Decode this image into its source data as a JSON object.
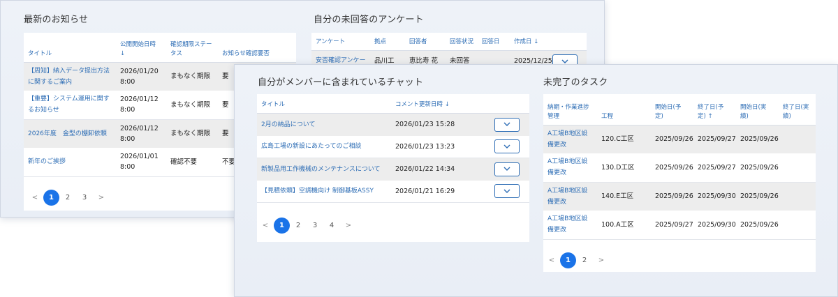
{
  "back": {
    "news": {
      "title": "最新のお知らせ",
      "headers": [
        "タイトル",
        "公開開始日時 ↓",
        "確認期限ステータス",
        "お知らせ確認要否"
      ],
      "rows": [
        {
          "title": "【周知】納入データ提出方法に関するご案内",
          "date": "2026/01/20",
          "time": "8:00",
          "status": "まもなく期限",
          "req": "要"
        },
        {
          "title": "【重要】システム運用に関するお知らせ",
          "date": "2026/01/12",
          "time": "8:00",
          "status": "まもなく期限",
          "req": "要"
        },
        {
          "title": "2026年度　金型の棚卸依頼",
          "date": "2026/01/12",
          "time": "8:00",
          "status": "まもなく期限",
          "req": "要"
        },
        {
          "title": "新年のご挨拶",
          "date": "2026/01/01",
          "time": "8:00",
          "status": "確認不要",
          "req": "不要"
        }
      ],
      "pager": {
        "prev": "<",
        "pages": [
          "1",
          "2",
          "3"
        ],
        "next": ">"
      }
    },
    "survey": {
      "title": "自分の未回答のアンケート",
      "headers": [
        "アンケート",
        "拠点",
        "回答者",
        "回答状況",
        "回答日",
        "作成日 ↓"
      ],
      "row": {
        "name": "安否確認アンケー",
        "site": "品川工",
        "person": "恵比寿 花",
        "status": "未回答",
        "answered": "",
        "created": "2025/12/25"
      }
    }
  },
  "front": {
    "chat": {
      "title": "自分がメンバーに含まれているチャット",
      "headers": [
        "タイトル",
        "コメント更新日時 ↓"
      ],
      "rows": [
        {
          "title": "2月の納品について",
          "datetime": "2026/01/23 15:28"
        },
        {
          "title": "広島工場の新設にあたってのご相談",
          "datetime": "2026/01/23 13:23"
        },
        {
          "title": "新製品用工作機械のメンテナンスについて",
          "datetime": "2026/01/22 14:34"
        },
        {
          "title": "【見積依頼】空調機向け 制御基板ASSY",
          "datetime": "2026/01/21 16:29"
        }
      ],
      "pager": {
        "prev": "<",
        "pages": [
          "1",
          "2",
          "3",
          "4"
        ],
        "next": ">"
      }
    },
    "tasks": {
      "title": "未完了のタスク",
      "headers": [
        "納期・作業進捗管理",
        "工程",
        "開始日(予定)",
        "終了日(予定) ↑",
        "開始日(実績)",
        "終了日(実績)"
      ],
      "rows": [
        {
          "name": "A工場B地区設備更改",
          "step": "120.C工区",
          "start_plan": "2025/09/26",
          "end_plan": "2025/09/27",
          "start_act": "2025/09/26",
          "end_act": ""
        },
        {
          "name": "A工場B地区設備更改",
          "step": "130.D工区",
          "start_plan": "2025/09/26",
          "end_plan": "2025/09/27",
          "start_act": "2025/09/26",
          "end_act": ""
        },
        {
          "name": "A工場B地区設備更改",
          "step": "140.E工区",
          "start_plan": "2025/09/26",
          "end_plan": "2025/09/30",
          "start_act": "2025/09/26",
          "end_act": ""
        },
        {
          "name": "A工場B地区設備更改",
          "step": "100.A工区",
          "start_plan": "2025/09/27",
          "end_plan": "2025/09/30",
          "start_act": "2025/09/26",
          "end_act": ""
        }
      ],
      "pager": {
        "prev": "<",
        "pages": [
          "1",
          "2"
        ],
        "next": ">"
      }
    }
  },
  "colors": {
    "accent": "#2d6db5",
    "current_page": "#1a73e8",
    "alt_row": "#ededed"
  },
  "icons": {
    "expand": "chevron-down-icon"
  }
}
